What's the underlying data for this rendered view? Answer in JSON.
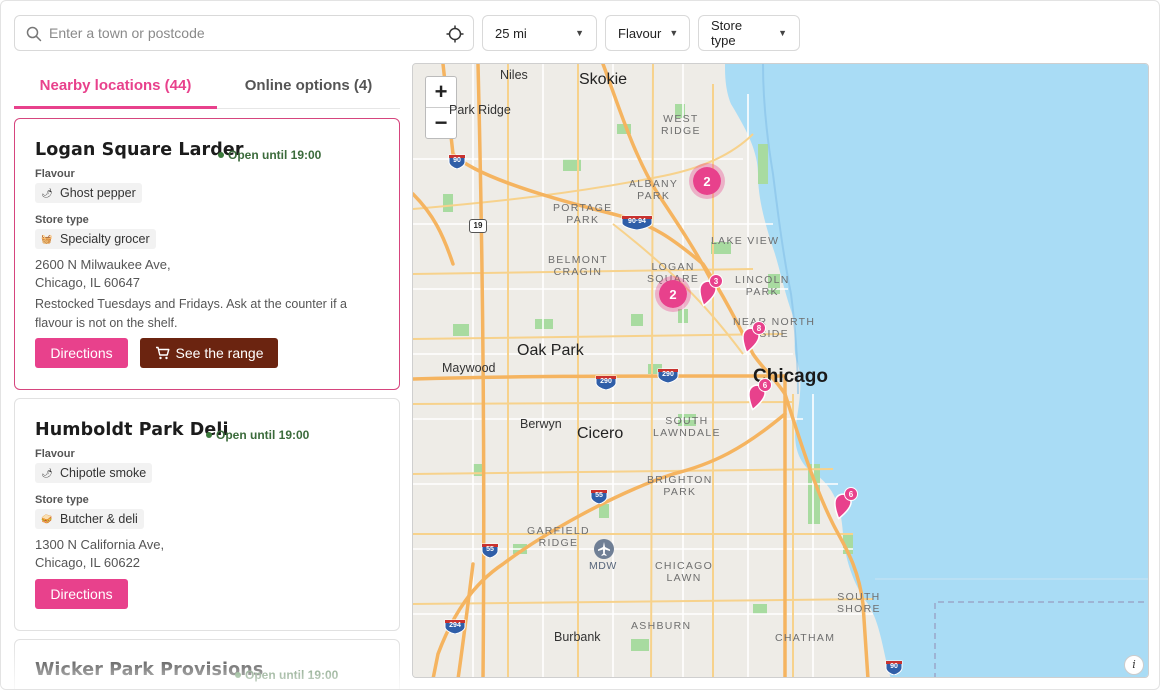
{
  "search": {
    "placeholder": "Enter a town or postcode"
  },
  "filters": {
    "radius": "25 mi",
    "flavour": "Flavour",
    "store_type": "Store type"
  },
  "tabs": [
    {
      "label": "Nearby locations (44)"
    },
    {
      "label": "Online options (4)"
    }
  ],
  "stores": [
    {
      "name": "Logan Square Larder",
      "status": "Open until 19:00",
      "flavour_label": "Flavour",
      "flavour": "Ghost pepper",
      "store_type_label": "Store type",
      "store_type": "Specialty grocer",
      "address_line1": "2600 N Milwaukee Ave,",
      "address_line2": "Chicago, IL 60647",
      "note": "Restocked Tuesdays and Fridays. Ask at the counter if a flavour is not on the shelf.",
      "directions": "Directions",
      "range": "See the range"
    },
    {
      "name": "Humboldt Park Deli",
      "status": "Open until 19:00",
      "flavour_label": "Flavour",
      "flavour": "Chipotle smoke",
      "store_type_label": "Store type",
      "store_type": "Butcher & deli",
      "address_line1": "1300 N California Ave,",
      "address_line2": "Chicago, IL 60622",
      "directions": "Directions"
    },
    {
      "name": "Wicker Park Provisions",
      "status": "Open until 19:00"
    }
  ],
  "map": {
    "zoom_in": "+",
    "zoom_out": "−",
    "info": "i",
    "places": {
      "niles": "Niles",
      "skokie": "Skokie",
      "park_ridge": "Park Ridge",
      "oak_park": "Oak Park",
      "maywood": "Maywood",
      "chicago": "Chicago",
      "berwyn": "Berwyn",
      "cicero": "Cicero",
      "burbank": "Burbank"
    },
    "neighborhoods": {
      "west_ridge_1": "WEST",
      "west_ridge_2": "RIDGE",
      "albany_park_1": "ALBANY",
      "albany_park_2": "PARK",
      "portage_park_1": "PORTAGE",
      "portage_park_2": "PARK",
      "lake_view": "LAKE VIEW",
      "belmont_cragin_1": "BELMONT",
      "belmont_cragin_2": "CRAGIN",
      "logan_square_1": "LOGAN",
      "logan_square_2": "SQUARE",
      "lincoln_park_1": "LINCOLN",
      "lincoln_park_2": "PARK",
      "near_north_1": "NEAR NORTH",
      "near_north_2": "SIDE",
      "south_lawndale_1": "SOUTH",
      "south_lawndale_2": "LAWNDALE",
      "brighton_park_1": "BRIGHTON",
      "brighton_park_2": "PARK",
      "garfield_ridge_1": "GARFIELD",
      "garfield_ridge_2": "RIDGE",
      "mdw": "MDW",
      "chicago_lawn_1": "CHICAGO",
      "chicago_lawn_2": "LAWN",
      "south_shore_1": "SOUTH",
      "south_shore_2": "SHORE",
      "ashburn": "ASHBURN",
      "chatham": "CHATHAM"
    },
    "shields": {
      "i90_north": "90",
      "i90_94": "90·94",
      "us19": "19",
      "i290_west": "290",
      "i290_east": "290",
      "i55_mid": "55",
      "i55_west": "55",
      "i294": "294",
      "i90_south": "90"
    },
    "clusters": [
      {
        "count": "2"
      },
      {
        "count": "2"
      }
    ],
    "pins": [
      {
        "count": "3"
      },
      {
        "count": "8"
      },
      {
        "count": "6"
      },
      {
        "count": "6"
      }
    ],
    "colors": {
      "water": "#a9dcf5",
      "land": "#eeece7",
      "park": "#a8dba0",
      "highway": "#f5b460",
      "accent": "#e8418c"
    }
  }
}
